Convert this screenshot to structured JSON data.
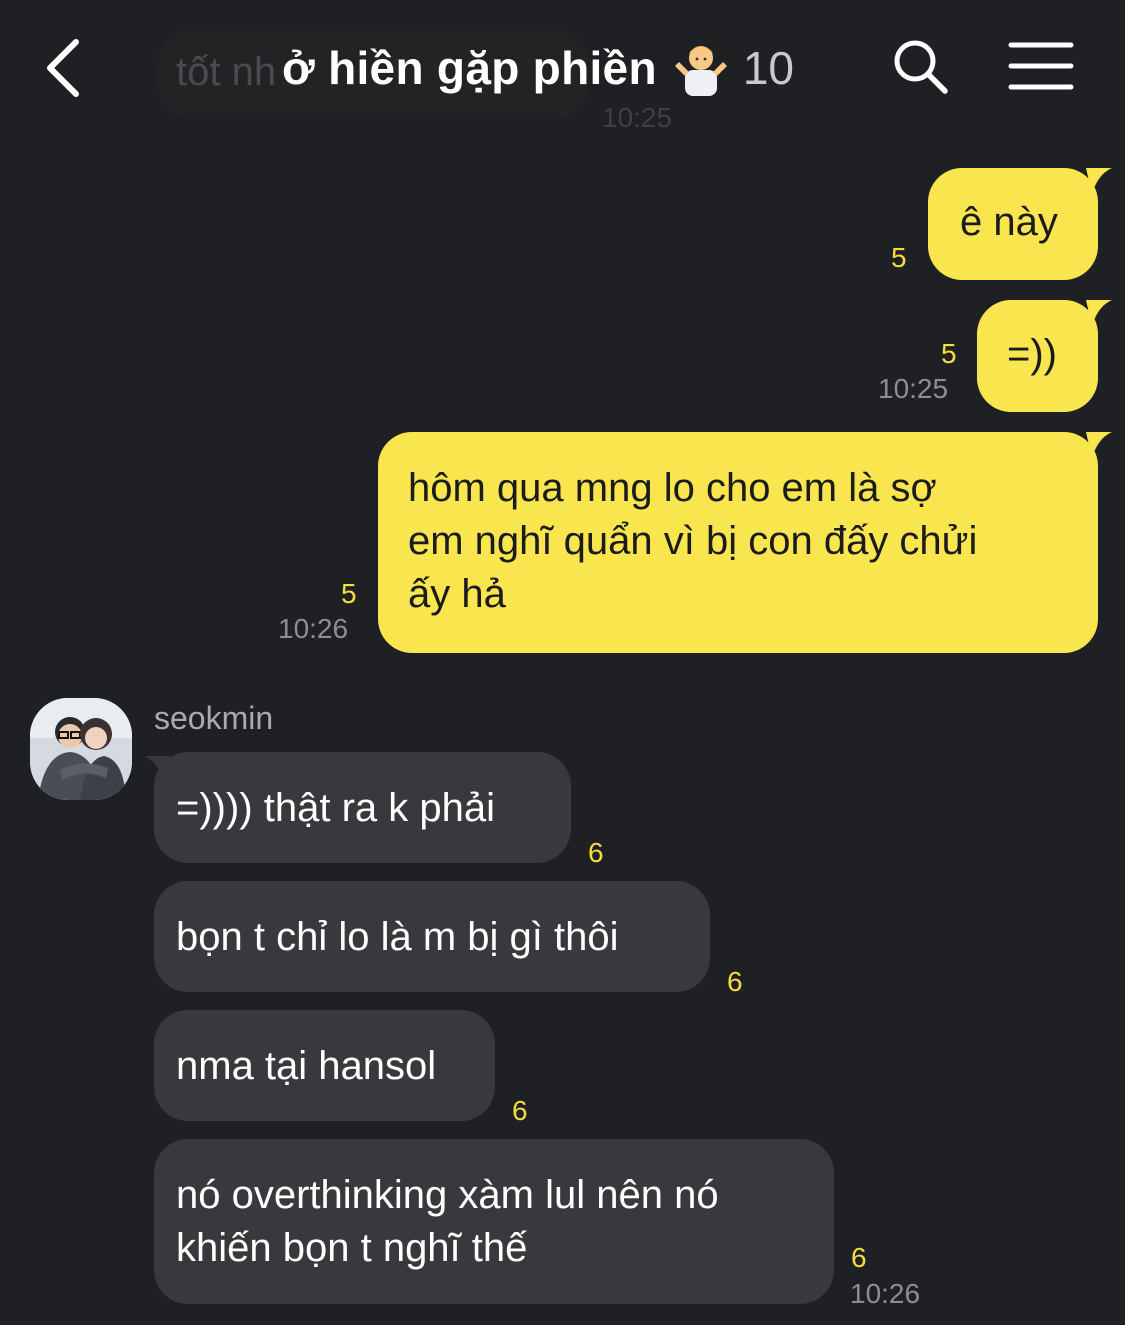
{
  "header": {
    "title": "ở hiền gặp phiền",
    "member_count": "10",
    "emoji": "person-shrugging-emoji"
  },
  "background_message": {
    "text": "tốt nh",
    "time": "10:25"
  },
  "messages": [
    {
      "side": "out",
      "text": "ê này",
      "unread": "5",
      "time": ""
    },
    {
      "side": "out",
      "text": "=))",
      "unread": "5",
      "time": "10:25"
    },
    {
      "side": "out",
      "lines": [
        "hôm qua mng lo cho em là sợ",
        "em nghĩ quẩn vì bị con đấy chửi",
        "ấy hả"
      ],
      "unread": "5",
      "time": "10:26"
    },
    {
      "side": "in",
      "sender": "seokmin",
      "text": "=)))) thật ra k phải",
      "unread": "6",
      "time": ""
    },
    {
      "side": "in",
      "text": "bọn t chỉ lo là m bị gì thôi",
      "unread": "6",
      "time": ""
    },
    {
      "side": "in",
      "text": "nma tại hansol",
      "unread": "6",
      "time": ""
    },
    {
      "side": "in",
      "lines": [
        "nó overthinking xàm lul nên nó",
        "khiến bọn t nghĩ thế"
      ],
      "unread": "6",
      "time": "10:26"
    }
  ],
  "colors": {
    "background": "#1f2023",
    "outgoing_bubble": "#f9e54e",
    "incoming_bubble": "#38393d",
    "unread_count": "#f3dc3e",
    "timestamp": "#8d8e92"
  }
}
